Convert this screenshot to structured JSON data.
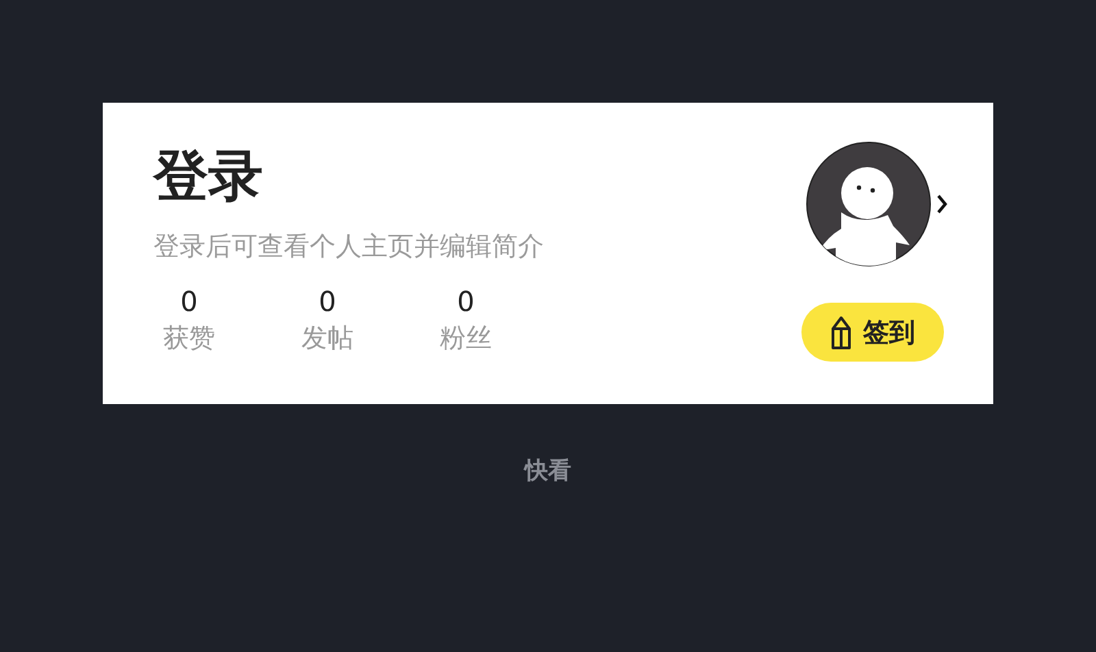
{
  "profile_card": {
    "title": "登录",
    "subtitle": "登录后可查看个人主页并编辑简介",
    "stats": [
      {
        "value": "0",
        "label": "获赞"
      },
      {
        "value": "0",
        "label": "发帖"
      },
      {
        "value": "0",
        "label": "粉丝"
      }
    ],
    "checkin_button": "签到"
  },
  "app_name": "快看"
}
